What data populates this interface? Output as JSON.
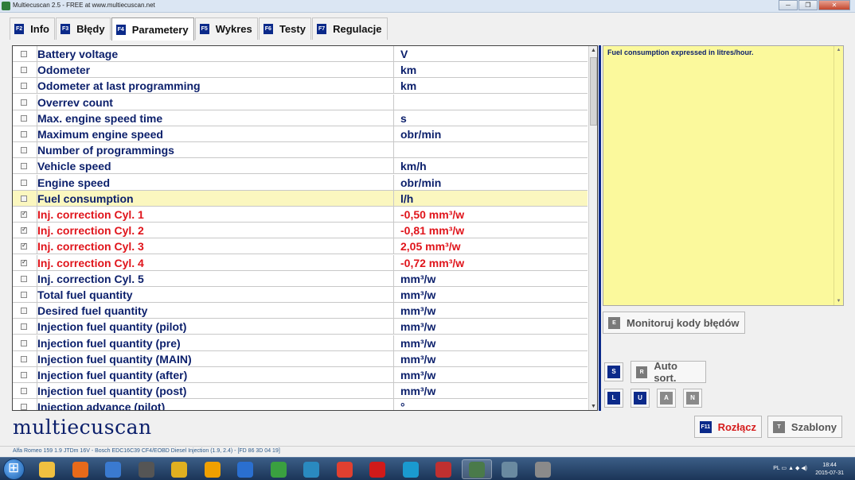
{
  "window": {
    "title": "Multiecuscan 2.5 - FREE at www.multiecuscan.net",
    "minimize": "─",
    "maximize": "❐",
    "close": "✕"
  },
  "tabs": [
    {
      "key": "F2",
      "label": "Info",
      "active": false
    },
    {
      "key": "F3",
      "label": "Błędy",
      "active": false
    },
    {
      "key": "F4",
      "label": "Parametery",
      "active": true
    },
    {
      "key": "F5",
      "label": "Wykres",
      "active": false
    },
    {
      "key": "F6",
      "label": "Testy",
      "active": false
    },
    {
      "key": "F7",
      "label": "Regulacje",
      "active": false
    }
  ],
  "parameters": [
    {
      "name": "Battery voltage",
      "value": "V",
      "checked": false,
      "highlight": false,
      "selected": false
    },
    {
      "name": "Odometer",
      "value": "km",
      "checked": false,
      "highlight": false,
      "selected": false
    },
    {
      "name": "Odometer at last programming",
      "value": "km",
      "checked": false,
      "highlight": false,
      "selected": false
    },
    {
      "name": "Overrev count",
      "value": "",
      "checked": false,
      "highlight": false,
      "selected": false
    },
    {
      "name": "Max. engine speed time",
      "value": "s",
      "checked": false,
      "highlight": false,
      "selected": false
    },
    {
      "name": "Maximum engine speed",
      "value": "obr/min",
      "checked": false,
      "highlight": false,
      "selected": false
    },
    {
      "name": "Number of programmings",
      "value": "",
      "checked": false,
      "highlight": false,
      "selected": false
    },
    {
      "name": "Vehicle speed",
      "value": "km/h",
      "checked": false,
      "highlight": false,
      "selected": false
    },
    {
      "name": "Engine speed",
      "value": "obr/min",
      "checked": false,
      "highlight": false,
      "selected": false
    },
    {
      "name": "Fuel consumption",
      "value": "l/h",
      "checked": false,
      "highlight": false,
      "selected": true
    },
    {
      "name": "Inj. correction Cyl. 1",
      "value": "-0,50 mm³/w",
      "checked": true,
      "highlight": true,
      "selected": false
    },
    {
      "name": "Inj. correction Cyl. 2",
      "value": "-0,81 mm³/w",
      "checked": true,
      "highlight": true,
      "selected": false
    },
    {
      "name": "Inj. correction Cyl. 3",
      "value": "2,05 mm³/w",
      "checked": true,
      "highlight": true,
      "selected": false
    },
    {
      "name": "Inj. correction Cyl. 4",
      "value": "-0,72 mm³/w",
      "checked": true,
      "highlight": true,
      "selected": false
    },
    {
      "name": "Inj. correction Cyl. 5",
      "value": "mm³/w",
      "checked": false,
      "highlight": false,
      "selected": false
    },
    {
      "name": "Total fuel quantity",
      "value": "mm³/w",
      "checked": false,
      "highlight": false,
      "selected": false
    },
    {
      "name": "Desired fuel quantity",
      "value": "mm³/w",
      "checked": false,
      "highlight": false,
      "selected": false
    },
    {
      "name": "Injection fuel quantity (pilot)",
      "value": "mm³/w",
      "checked": false,
      "highlight": false,
      "selected": false
    },
    {
      "name": "Injection fuel quantity (pre)",
      "value": "mm³/w",
      "checked": false,
      "highlight": false,
      "selected": false
    },
    {
      "name": "Injection fuel quantity (MAIN)",
      "value": "mm³/w",
      "checked": false,
      "highlight": false,
      "selected": false
    },
    {
      "name": "Injection fuel quantity (after)",
      "value": "mm³/w",
      "checked": false,
      "highlight": false,
      "selected": false
    },
    {
      "name": "Injection fuel quantity (post)",
      "value": "mm³/w",
      "checked": false,
      "highlight": false,
      "selected": false
    },
    {
      "name": "Injection advance (pilot)",
      "value": "°",
      "checked": false,
      "highlight": false,
      "selected": false
    }
  ],
  "description": {
    "text": "Fuel consumption expressed in litres/hour."
  },
  "buttons": {
    "monitor": {
      "key": "E",
      "label": "Monitoruj kody błędów"
    },
    "s": {
      "key": "S"
    },
    "auto_sort": {
      "key": "R",
      "label": "Auto sort."
    },
    "l": {
      "key": "L"
    },
    "u": {
      "key": "U"
    },
    "a": {
      "key": "A"
    },
    "n": {
      "key": "N"
    },
    "disconnect": {
      "key": "F11",
      "label": "Rozłącz"
    },
    "templates": {
      "key": "T",
      "label": "Szablony"
    }
  },
  "logo": "multiecuscan",
  "status_bar": "Alfa Romeo 159 1.9 JTDm 16V - Bosch EDC16C39 CF4/EOBD Diesel Injection (1.9, 2.4) - [FD 86 3D 04 19]",
  "taskbar": {
    "icons": [
      "explorer-icon",
      "firefox-icon",
      "media-player-icon",
      "clapper-icon",
      "sword-icon",
      "tool-icon",
      "lightning-icon",
      "utorrent-icon",
      "globe-icon",
      "chrome-icon",
      "opera-icon",
      "skype-icon",
      "car-icon",
      "multiecuscan-icon",
      "window-icon",
      "tools-icon"
    ],
    "active_icon": "multiecuscan-icon",
    "lang": "PL",
    "time": "18:44",
    "date": "2015-07-31"
  },
  "colors": {
    "accent": "#0b2a8a",
    "row_text": "#0b1f6b",
    "highlight_text": "#e0141b",
    "selected_row": "#fbf7bf",
    "description_bg": "#fbf99c"
  }
}
